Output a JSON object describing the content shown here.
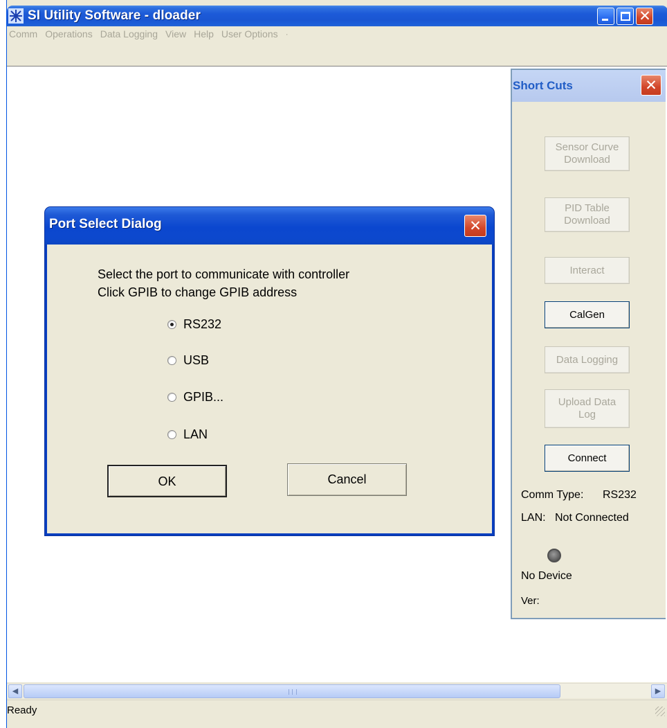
{
  "window": {
    "title": "SI Utility Software - dloader",
    "icon": "app-snowflake-icon"
  },
  "menu": {
    "items": [
      "Comm",
      "Operations",
      "Data Logging",
      "View",
      "Help",
      "User Options"
    ],
    "tail": "·"
  },
  "status": {
    "text": "Ready"
  },
  "shortcuts": {
    "title": "Short Cuts",
    "buttons": {
      "sensor_curve": [
        "Sensor Curve",
        "Download"
      ],
      "pid_table": [
        "PID Table",
        "Download"
      ],
      "interact": "Interact",
      "calgen": "CalGen",
      "data_logging": "Data Logging",
      "upload_log": [
        "Upload Data",
        "Log"
      ],
      "connect": "Connect"
    },
    "comm_type_label": "Comm Type:",
    "comm_type_value": "RS232",
    "lan_label": "LAN:",
    "lan_value": "Not Connected",
    "device": "No Device",
    "ver": "Ver:"
  },
  "dialog": {
    "title": "Port Select Dialog",
    "message_line1": "Select the port to communicate with controller",
    "message_line2": "Click GPIB to change GPIB address",
    "options": [
      {
        "label": "RS232",
        "checked": true
      },
      {
        "label": "USB",
        "checked": false
      },
      {
        "label": "GPIB...",
        "checked": false
      },
      {
        "label": "LAN",
        "checked": false
      }
    ],
    "ok_label": "OK",
    "cancel_label": "Cancel"
  },
  "colors": {
    "titlebar": "#1c5ad8",
    "window_bg": "#ece9d8",
    "close_button": "#d2462a",
    "disabled_text": "#a9a79b"
  }
}
